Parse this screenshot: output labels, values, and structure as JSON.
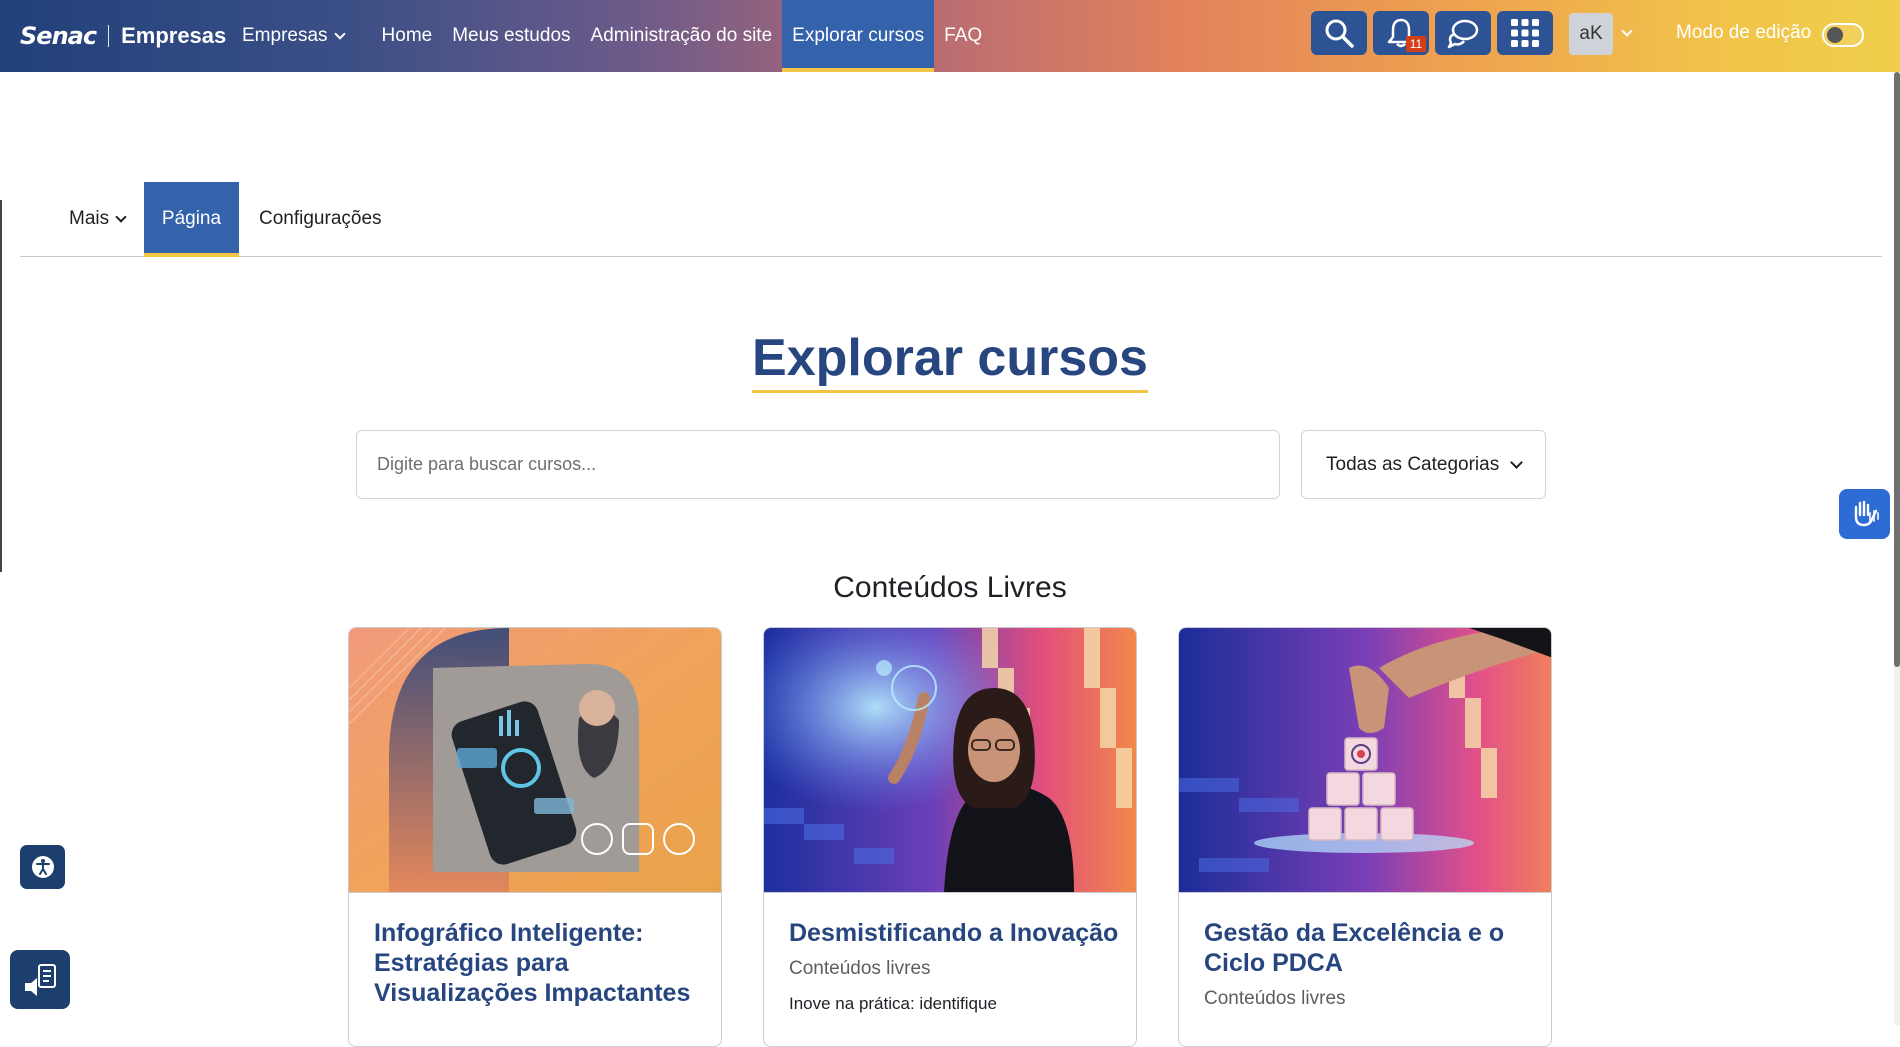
{
  "brand": {
    "senac": "Senac",
    "empresas": "Empresas"
  },
  "navbar": {
    "items": [
      {
        "label": "Empresas"
      },
      {
        "label": "Home"
      },
      {
        "label": "Meus estudos"
      },
      {
        "label": "Administração do site"
      },
      {
        "label": "Explorar cursos"
      },
      {
        "label": "FAQ"
      }
    ],
    "active": "Explorar cursos",
    "notifications_count": "11",
    "avatar_initials": "aK",
    "edit_mode_label": "Modo de edição",
    "edit_mode_on": false
  },
  "secondary_nav": {
    "items": [
      {
        "label": "Mais"
      },
      {
        "label": "Página"
      },
      {
        "label": "Configurações"
      }
    ],
    "active": "Página"
  },
  "main": {
    "title": "Explorar cursos",
    "search_placeholder": "Digite para buscar cursos...",
    "category_select": "Todas as Categorias",
    "section_title": "Conteúdos Livres"
  },
  "cards": [
    {
      "title": "Infográfico Inteligente: Estratégias para Visualizações Impactantes",
      "category": "",
      "description": ""
    },
    {
      "title": "Desmistificando a Inovação",
      "category": "Conteúdos livres",
      "description": "Inove na prática: identifique"
    },
    {
      "title": "Gestão da Excelência e o Ciclo PDCA",
      "category": "Conteúdos livres",
      "description": ""
    }
  ],
  "colors": {
    "primary": "#27467f",
    "nav_active": "#3463ab",
    "accent": "#f2c542",
    "badge": "#d43f1a"
  },
  "icons": [
    "search-icon",
    "bell-icon",
    "chat-icon",
    "apps-grid-icon",
    "sign-language-icon",
    "accessibility-icon",
    "screen-reader-icon"
  ]
}
